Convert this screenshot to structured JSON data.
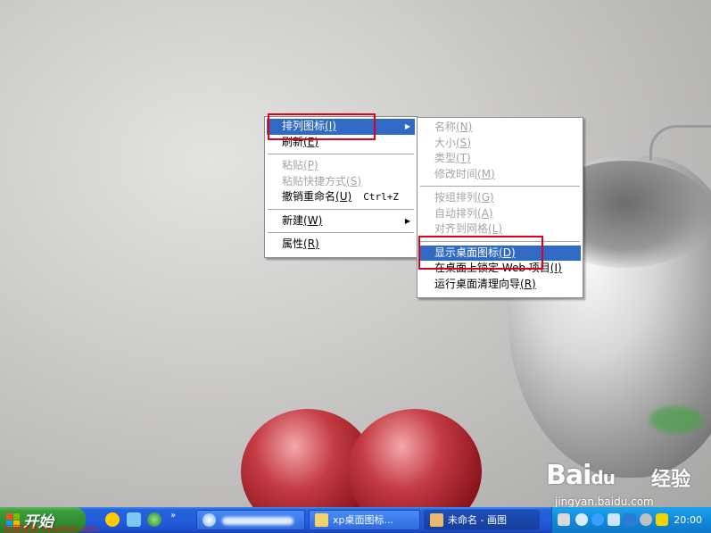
{
  "desktop": {
    "watermark": {
      "logo_bai": "Bai",
      "logo_du": "du",
      "logo_jingyan": "经验",
      "url": "jingyan.baidu.com"
    }
  },
  "context_menu": {
    "items": [
      {
        "label": "排列图标",
        "shortcut": "(I)",
        "state": "highlight",
        "submenu": true
      },
      {
        "label": "刷新",
        "shortcut": "(E)",
        "state": "normal"
      },
      {
        "label": "粘贴",
        "shortcut": "(P)",
        "state": "disabled"
      },
      {
        "label": "粘贴快捷方式",
        "shortcut": "(S)",
        "state": "disabled"
      },
      {
        "label": "撤销重命名",
        "shortcut": "(U)",
        "state": "normal",
        "accelerator": "Ctrl+Z"
      },
      {
        "label": "新建",
        "shortcut": "(W)",
        "state": "normal",
        "submenu": true
      },
      {
        "label": "属性",
        "shortcut": "(R)",
        "state": "normal"
      }
    ]
  },
  "submenu": {
    "items": [
      {
        "label": "名称",
        "shortcut": "(N)",
        "state": "disabled"
      },
      {
        "label": "大小",
        "shortcut": "(S)",
        "state": "disabled"
      },
      {
        "label": "类型",
        "shortcut": "(T)",
        "state": "disabled"
      },
      {
        "label": "修改时间",
        "shortcut": "(M)",
        "state": "disabled"
      },
      {
        "label": "按组排列",
        "shortcut": "(G)",
        "state": "disabled"
      },
      {
        "label": "自动排列",
        "shortcut": "(A)",
        "state": "disabled"
      },
      {
        "label": "对齐到网格",
        "shortcut": "(L)",
        "state": "disabled"
      },
      {
        "label": "显示桌面图标",
        "shortcut": "(D)",
        "state": "highlight"
      },
      {
        "label": "在桌面上锁定 Web 项目",
        "shortcut": "(I)",
        "state": "normal"
      },
      {
        "label": "运行桌面清理向导",
        "shortcut": "(R)",
        "state": "normal"
      }
    ]
  },
  "taskbar": {
    "start_label": "开始",
    "start_overlay_text": "百度经验 xyw860.com",
    "quicklaunch_more": "»",
    "tasks": [
      {
        "label": "",
        "blurred": true
      },
      {
        "label": "xp桌面图标..."
      },
      {
        "label": "未命名 - 画图"
      }
    ],
    "clock": "20:00"
  },
  "colors": {
    "highlight": "#316ac5",
    "annotation_box": "#e0001b",
    "taskbar_blue": "#245edb",
    "start_green": "#3c9c3c",
    "tray_blue": "#118ad9"
  }
}
